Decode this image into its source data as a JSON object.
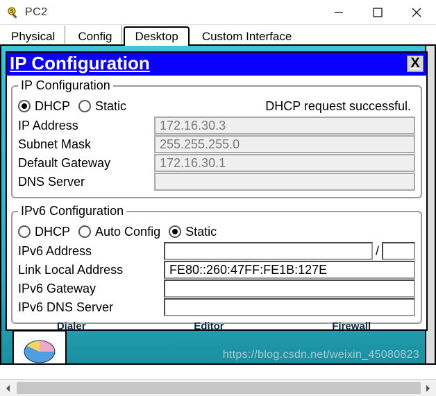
{
  "window": {
    "title": "PC2"
  },
  "tabs": {
    "items": [
      {
        "label": "Physical",
        "active": false
      },
      {
        "label": "Config",
        "active": false
      },
      {
        "label": "Desktop",
        "active": true
      },
      {
        "label": "Custom Interface",
        "active": false
      }
    ]
  },
  "dialog": {
    "title": "IP Configuration",
    "close": "X",
    "ipv4": {
      "legend": "IP Configuration",
      "radios": {
        "dhcp": "DHCP",
        "static": "Static",
        "selected": "dhcp"
      },
      "status": "DHCP request successful.",
      "fields": {
        "ip_label": "IP Address",
        "ip_value": "172.16.30.3",
        "mask_label": "Subnet Mask",
        "mask_value": "255.255.255.0",
        "gw_label": "Default Gateway",
        "gw_value": "172.16.30.1",
        "dns_label": "DNS Server",
        "dns_value": ""
      }
    },
    "ipv6": {
      "legend": "IPv6 Configuration",
      "radios": {
        "dhcp": "DHCP",
        "auto": "Auto Config",
        "static": "Static",
        "selected": "static"
      },
      "fields": {
        "addr_label": "IPv6 Address",
        "addr_value": "",
        "prefix_value": "",
        "ll_label": "Link Local Address",
        "ll_value": "FE80::260:47FF:FE1B:127E",
        "gw_label": "IPv6 Gateway",
        "gw_value": "",
        "dns_label": "IPv6 DNS Server",
        "dns_value": ""
      }
    }
  },
  "thumbnails": {
    "items": [
      "Dialer",
      "Editor",
      "Firewall"
    ]
  },
  "watermark": "https://blog.csdn.net/weixin_45080823"
}
